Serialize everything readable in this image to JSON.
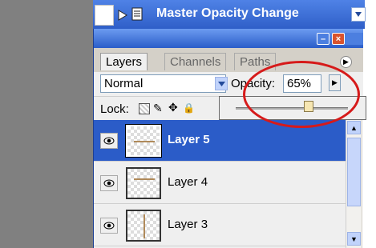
{
  "action": {
    "title": "Master Opacity Change"
  },
  "palette": {
    "tabs": [
      "Layers",
      "Channels",
      "Paths"
    ],
    "blend_mode": "Normal",
    "opacity_label": "Opacity:",
    "opacity_value": "65%",
    "opacity_level": 0.65,
    "lock_label": "Lock:",
    "layers": [
      {
        "name": "Layer 5",
        "selected": true
      },
      {
        "name": "Layer 4",
        "selected": false
      },
      {
        "name": "Layer 3",
        "selected": false
      }
    ]
  },
  "colors": {
    "selection": "#2b5cc8",
    "highlight_circle": "#d61a1a"
  },
  "icons": [
    "play-icon",
    "document-icon",
    "dropdown-arrow-icon",
    "minimize-icon",
    "close-icon",
    "palette-menu-icon",
    "eye-icon",
    "lock-transparent-icon",
    "lock-paint-icon",
    "lock-move-icon",
    "lock-all-icon",
    "scroll-up-icon",
    "scroll-down-icon"
  ]
}
